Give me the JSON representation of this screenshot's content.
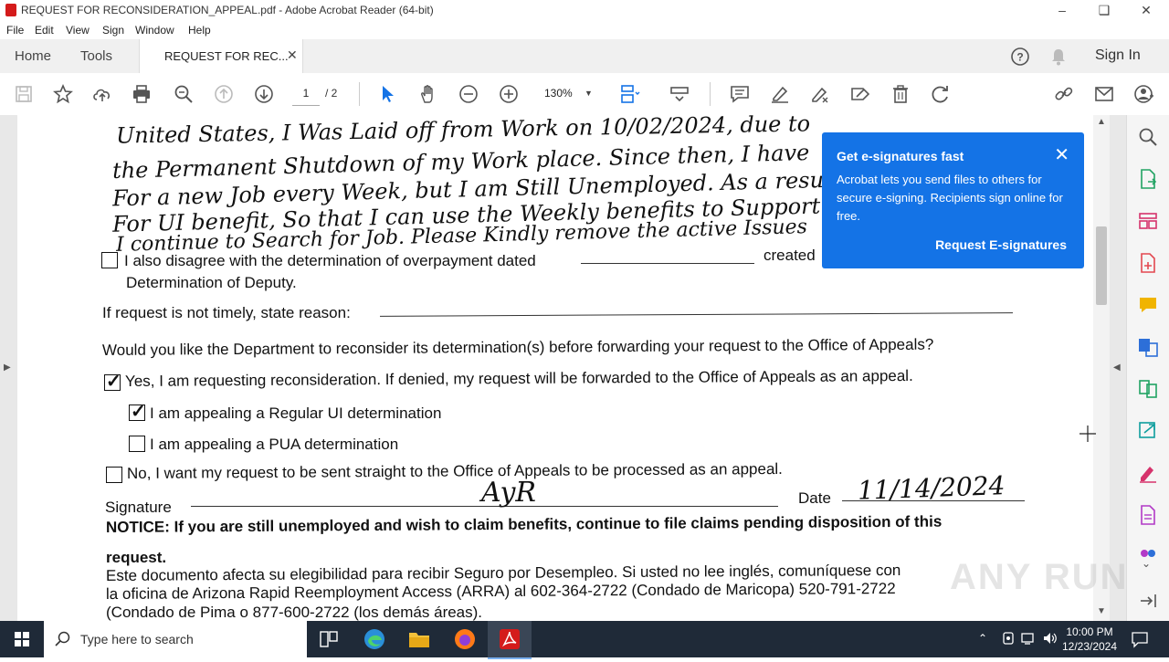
{
  "window": {
    "title": "REQUEST FOR RECONSIDERATION_APPEAL.pdf - Adobe Acrobat Reader (64-bit)"
  },
  "menu": [
    "File",
    "Edit",
    "View",
    "Sign",
    "Window",
    "Help"
  ],
  "tabs": {
    "home": "Home",
    "tools": "Tools",
    "doc": "REQUEST FOR REC...",
    "signin": "Sign In"
  },
  "toolbar": {
    "page_current": "1",
    "page_total": "/ 2",
    "zoom": "130%"
  },
  "document": {
    "handwriting": [
      "United States, I Was Laid off from Work on 10/02/2024, due to",
      "the Permanent Shutdown of my Work place. Since then, I have",
      "For a new Job every Week, but I am Still Unemployed. As a result",
      "For UI benefit, So that I can use the Weekly benefits to Support My",
      "I continue to Search for Job. Please Kindly remove the active Issues"
    ],
    "overpayment_line1_a": "I also disagree with the determination of overpayment dated",
    "overpayment_line1_b": "created",
    "overpayment_line2": "Determination of Deputy.",
    "timely_label": "If request is not timely, state reason:",
    "question": "Would you like the Department to reconsider its determination(s) before forwarding your request to the Office of Appeals?",
    "opt_yes": "Yes, I am requesting reconsideration. If denied, my request will be forwarded to the Office of Appeals as an appeal.",
    "opt_regular": "I am appealing a Regular UI determination",
    "opt_pua": "I am appealing a PUA determination",
    "opt_no": "No, I want my request to be sent straight to the Office of Appeals to be processed as an appeal.",
    "signature_label": "Signature",
    "signature_value": "AyR",
    "date_label": "Date",
    "date_value": "11/14/2024",
    "notice_line1": "NOTICE: If you are still unemployed and wish to claim benefits, continue to file claims pending disposition of this",
    "notice_line2": "request.",
    "spanish_line1": "Este documento afecta su elegibilidad para recibir Seguro por Desempleo. Si usted no lee inglés, comuníquese con",
    "spanish_line2": "la oficina de Arizona Rapid Reemployment Access (ARRA) al 602-364-2722 (Condado de Maricopa) 520-791-2722",
    "spanish_line3": "(Condado de Pima o 877-600-2722 (los demás áreas).",
    "checked": {
      "yes": true,
      "regular": true,
      "pua": false,
      "no": false,
      "overpayment": false
    }
  },
  "popup": {
    "title": "Get e-signatures fast",
    "body": "Acrobat lets you send files to others for secure e-signing. Recipients sign online for free.",
    "action": "Request E-signatures"
  },
  "taskbar": {
    "search_placeholder": "Type here to search",
    "time": "10:00 PM",
    "date": "12/23/2024"
  },
  "watermark": "ANY RUN",
  "colors": {
    "accent": "#1473e6",
    "acrobat_red": "#d41b1b",
    "taskbar": "#1f2a38"
  }
}
